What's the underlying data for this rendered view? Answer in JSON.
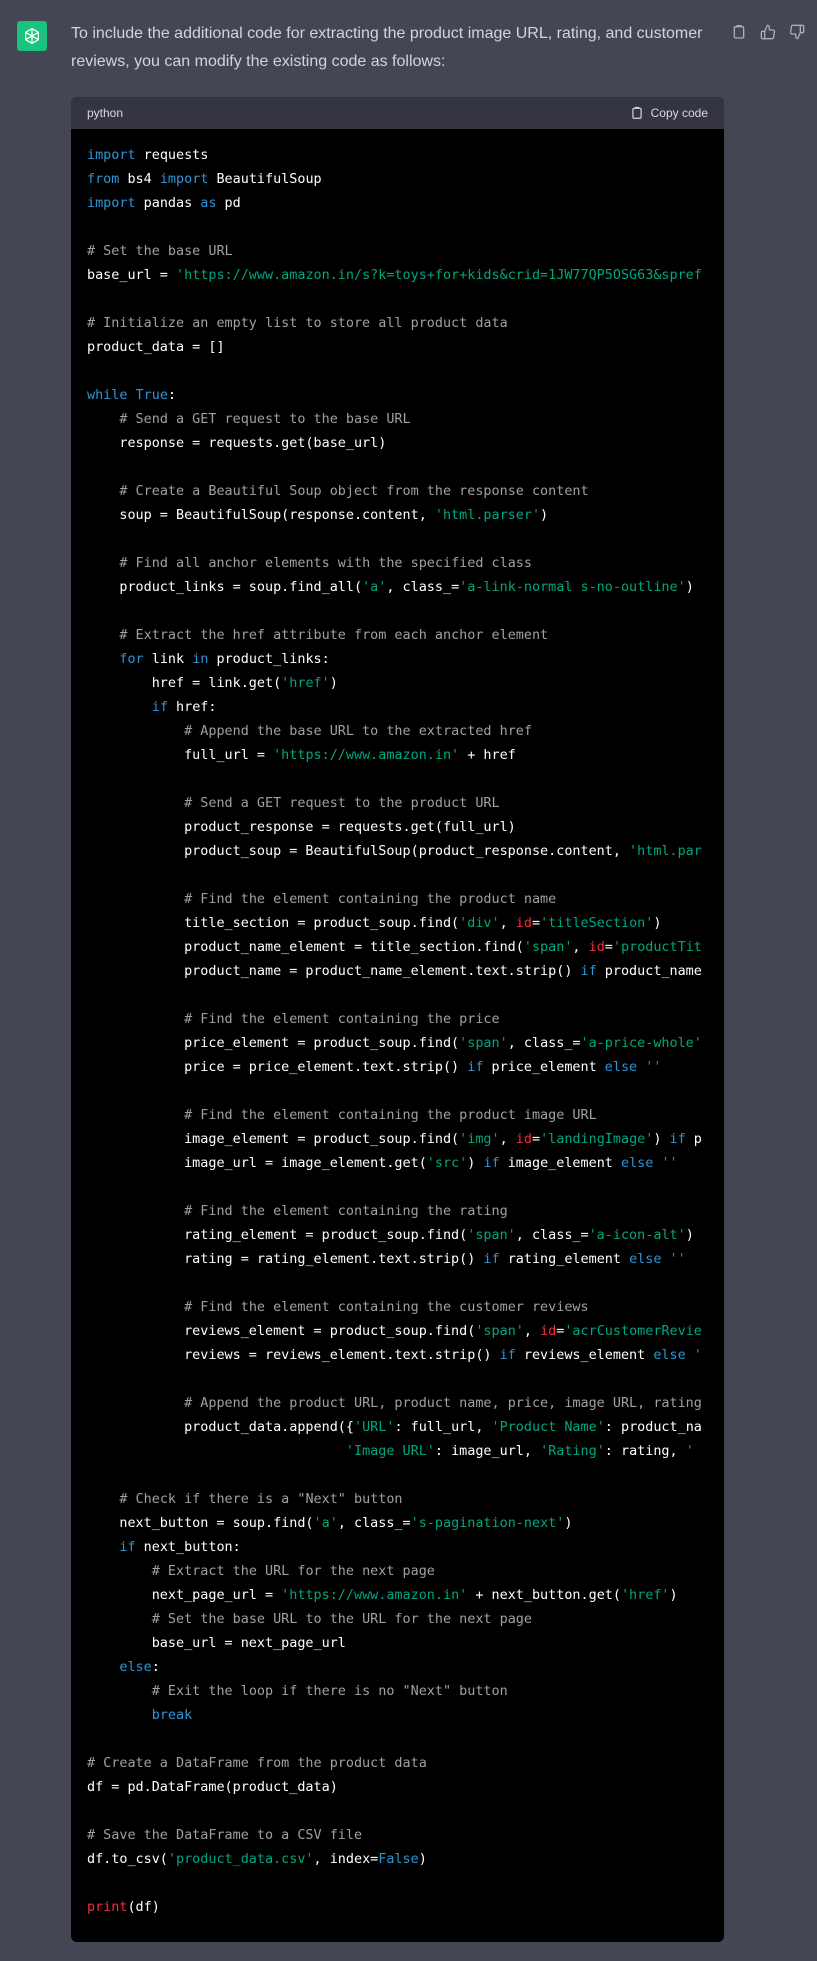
{
  "message": {
    "avatar_icon": "openai-logo-icon",
    "intro_text": "To include the additional code for extracting the product image URL, rating, and customer reviews, you can modify the existing code as follows:"
  },
  "actions": [
    {
      "name": "copy-message-icon"
    },
    {
      "name": "thumbs-up-icon"
    },
    {
      "name": "thumbs-down-icon"
    }
  ],
  "code_block": {
    "language": "python",
    "copy_label": "Copy code",
    "colors": {
      "keyword": "#2e95d3",
      "string": "#00a67d",
      "comment": "#a0a0a0",
      "builtin": "#f22c3d",
      "text": "#ffffff"
    },
    "lines": [
      [
        [
          "kw",
          "import"
        ],
        [
          "t",
          " requests"
        ]
      ],
      [
        [
          "kw",
          "from"
        ],
        [
          "t",
          " bs4 "
        ],
        [
          "kw",
          "import"
        ],
        [
          "t",
          " BeautifulSoup"
        ]
      ],
      [
        [
          "kw",
          "import"
        ],
        [
          "t",
          " pandas "
        ],
        [
          "kw",
          "as"
        ],
        [
          "t",
          " pd"
        ]
      ],
      [],
      [
        [
          "c",
          "# Set the base URL"
        ]
      ],
      [
        [
          "t",
          "base_url = "
        ],
        [
          "s",
          "'https://www.amazon.in/s?k=toys+for+kids&crid=1JW77QP5OSG63&spref"
        ]
      ],
      [],
      [
        [
          "c",
          "# Initialize an empty list to store all product data"
        ]
      ],
      [
        [
          "t",
          "product_data = []"
        ]
      ],
      [],
      [
        [
          "kw",
          "while"
        ],
        [
          "t",
          " "
        ],
        [
          "kw",
          "True"
        ],
        [
          "t",
          ":"
        ]
      ],
      [
        [
          "t",
          "    "
        ],
        [
          "c",
          "# Send a GET request to the base URL"
        ]
      ],
      [
        [
          "t",
          "    response = requests.get(base_url)"
        ]
      ],
      [],
      [
        [
          "t",
          "    "
        ],
        [
          "c",
          "# Create a Beautiful Soup object from the response content"
        ]
      ],
      [
        [
          "t",
          "    soup = BeautifulSoup(response.content, "
        ],
        [
          "s",
          "'html.parser'"
        ],
        [
          "t",
          ")"
        ]
      ],
      [],
      [
        [
          "t",
          "    "
        ],
        [
          "c",
          "# Find all anchor elements with the specified class"
        ]
      ],
      [
        [
          "t",
          "    product_links = soup.find_all("
        ],
        [
          "s",
          "'a'"
        ],
        [
          "t",
          ", class_="
        ],
        [
          "s",
          "'a-link-normal s-no-outline'"
        ],
        [
          "t",
          ")"
        ]
      ],
      [],
      [
        [
          "t",
          "    "
        ],
        [
          "c",
          "# Extract the href attribute from each anchor element"
        ]
      ],
      [
        [
          "t",
          "    "
        ],
        [
          "kw",
          "for"
        ],
        [
          "t",
          " link "
        ],
        [
          "kw",
          "in"
        ],
        [
          "t",
          " product_links:"
        ]
      ],
      [
        [
          "t",
          "        href = link.get("
        ],
        [
          "s",
          "'href'"
        ],
        [
          "t",
          ")"
        ]
      ],
      [
        [
          "t",
          "        "
        ],
        [
          "kw",
          "if"
        ],
        [
          "t",
          " href:"
        ]
      ],
      [
        [
          "t",
          "            "
        ],
        [
          "c",
          "# Append the base URL to the extracted href"
        ]
      ],
      [
        [
          "t",
          "            full_url = "
        ],
        [
          "s",
          "'https://www.amazon.in'"
        ],
        [
          "t",
          " + href"
        ]
      ],
      [],
      [
        [
          "t",
          "            "
        ],
        [
          "c",
          "# Send a GET request to the product URL"
        ]
      ],
      [
        [
          "t",
          "            product_response = requests.get(full_url)"
        ]
      ],
      [
        [
          "t",
          "            product_soup = BeautifulSoup(product_response.content, "
        ],
        [
          "s",
          "'html.par"
        ]
      ],
      [],
      [
        [
          "t",
          "            "
        ],
        [
          "c",
          "# Find the element containing the product name"
        ]
      ],
      [
        [
          "t",
          "            title_section = product_soup.find("
        ],
        [
          "s",
          "'div'"
        ],
        [
          "t",
          ", "
        ],
        [
          "fn",
          "id"
        ],
        [
          "t",
          "="
        ],
        [
          "s",
          "'titleSection'"
        ],
        [
          "t",
          ")"
        ]
      ],
      [
        [
          "t",
          "            product_name_element = title_section.find("
        ],
        [
          "s",
          "'span'"
        ],
        [
          "t",
          ", "
        ],
        [
          "fn",
          "id"
        ],
        [
          "t",
          "="
        ],
        [
          "s",
          "'productTit"
        ]
      ],
      [
        [
          "t",
          "            product_name = product_name_element.text.strip() "
        ],
        [
          "kw",
          "if"
        ],
        [
          "t",
          " product_name"
        ]
      ],
      [],
      [
        [
          "t",
          "            "
        ],
        [
          "c",
          "# Find the element containing the price"
        ]
      ],
      [
        [
          "t",
          "            price_element = product_soup.find("
        ],
        [
          "s",
          "'span'"
        ],
        [
          "t",
          ", class_="
        ],
        [
          "s",
          "'a-price-whole'"
        ]
      ],
      [
        [
          "t",
          "            price = price_element.text.strip() "
        ],
        [
          "kw",
          "if"
        ],
        [
          "t",
          " price_element "
        ],
        [
          "kw",
          "else"
        ],
        [
          "t",
          " "
        ],
        [
          "s",
          "''"
        ]
      ],
      [],
      [
        [
          "t",
          "            "
        ],
        [
          "c",
          "# Find the element containing the product image URL"
        ]
      ],
      [
        [
          "t",
          "            image_element = product_soup.find("
        ],
        [
          "s",
          "'img'"
        ],
        [
          "t",
          ", "
        ],
        [
          "fn",
          "id"
        ],
        [
          "t",
          "="
        ],
        [
          "s",
          "'landingImage'"
        ],
        [
          "t",
          ") "
        ],
        [
          "kw",
          "if"
        ],
        [
          "t",
          " p"
        ]
      ],
      [
        [
          "t",
          "            image_url = image_element.get("
        ],
        [
          "s",
          "'src'"
        ],
        [
          "t",
          ") "
        ],
        [
          "kw",
          "if"
        ],
        [
          "t",
          " image_element "
        ],
        [
          "kw",
          "else"
        ],
        [
          "t",
          " "
        ],
        [
          "s",
          "''"
        ]
      ],
      [],
      [
        [
          "t",
          "            "
        ],
        [
          "c",
          "# Find the element containing the rating"
        ]
      ],
      [
        [
          "t",
          "            rating_element = product_soup.find("
        ],
        [
          "s",
          "'span'"
        ],
        [
          "t",
          ", class_="
        ],
        [
          "s",
          "'a-icon-alt'"
        ],
        [
          "t",
          ")"
        ]
      ],
      [
        [
          "t",
          "            rating = rating_element.text.strip() "
        ],
        [
          "kw",
          "if"
        ],
        [
          "t",
          " rating_element "
        ],
        [
          "kw",
          "else"
        ],
        [
          "t",
          " "
        ],
        [
          "s",
          "''"
        ]
      ],
      [],
      [
        [
          "t",
          "            "
        ],
        [
          "c",
          "# Find the element containing the customer reviews"
        ]
      ],
      [
        [
          "t",
          "            reviews_element = product_soup.find("
        ],
        [
          "s",
          "'span'"
        ],
        [
          "t",
          ", "
        ],
        [
          "fn",
          "id"
        ],
        [
          "t",
          "="
        ],
        [
          "s",
          "'acrCustomerRevie"
        ]
      ],
      [
        [
          "t",
          "            reviews = reviews_element.text.strip() "
        ],
        [
          "kw",
          "if"
        ],
        [
          "t",
          " reviews_element "
        ],
        [
          "kw",
          "else"
        ],
        [
          "t",
          " "
        ],
        [
          "s",
          "'"
        ]
      ],
      [],
      [
        [
          "t",
          "            "
        ],
        [
          "c",
          "# Append the product URL, product name, price, image URL, rating"
        ]
      ],
      [
        [
          "t",
          "            product_data.append({"
        ],
        [
          "s",
          "'URL'"
        ],
        [
          "t",
          ": full_url, "
        ],
        [
          "s",
          "'Product Name'"
        ],
        [
          "t",
          ": product_na"
        ]
      ],
      [
        [
          "t",
          "                                "
        ],
        [
          "s",
          "'Image URL'"
        ],
        [
          "t",
          ": image_url, "
        ],
        [
          "s",
          "'Rating'"
        ],
        [
          "t",
          ": rating, "
        ],
        [
          "s",
          "'"
        ]
      ],
      [],
      [
        [
          "t",
          "    "
        ],
        [
          "c",
          "# Check if there is a \"Next\" button"
        ]
      ],
      [
        [
          "t",
          "    next_button = soup.find("
        ],
        [
          "s",
          "'a'"
        ],
        [
          "t",
          ", class_="
        ],
        [
          "s",
          "'s-pagination-next'"
        ],
        [
          "t",
          ")"
        ]
      ],
      [
        [
          "t",
          "    "
        ],
        [
          "kw",
          "if"
        ],
        [
          "t",
          " next_button:"
        ]
      ],
      [
        [
          "t",
          "        "
        ],
        [
          "c",
          "# Extract the URL for the next page"
        ]
      ],
      [
        [
          "t",
          "        next_page_url = "
        ],
        [
          "s",
          "'https://www.amazon.in'"
        ],
        [
          "t",
          " + next_button.get("
        ],
        [
          "s",
          "'href'"
        ],
        [
          "t",
          ")"
        ]
      ],
      [
        [
          "t",
          "        "
        ],
        [
          "c",
          "# Set the base URL to the URL for the next page"
        ]
      ],
      [
        [
          "t",
          "        base_url = next_page_url"
        ]
      ],
      [
        [
          "t",
          "    "
        ],
        [
          "kw",
          "else"
        ],
        [
          "t",
          ":"
        ]
      ],
      [
        [
          "t",
          "        "
        ],
        [
          "c",
          "# Exit the loop if there is no \"Next\" button"
        ]
      ],
      [
        [
          "t",
          "        "
        ],
        [
          "kw",
          "break"
        ]
      ],
      [],
      [
        [
          "c",
          "# Create a DataFrame from the product data"
        ]
      ],
      [
        [
          "t",
          "df = pd.DataFrame(product_data)"
        ]
      ],
      [],
      [
        [
          "c",
          "# Save the DataFrame to a CSV file"
        ]
      ],
      [
        [
          "t",
          "df.to_csv("
        ],
        [
          "s",
          "'product_data.csv'"
        ],
        [
          "t",
          ", index="
        ],
        [
          "kw",
          "False"
        ],
        [
          "t",
          ")"
        ]
      ],
      [],
      [
        [
          "fn",
          "print"
        ],
        [
          "t",
          "(df)"
        ]
      ]
    ]
  }
}
